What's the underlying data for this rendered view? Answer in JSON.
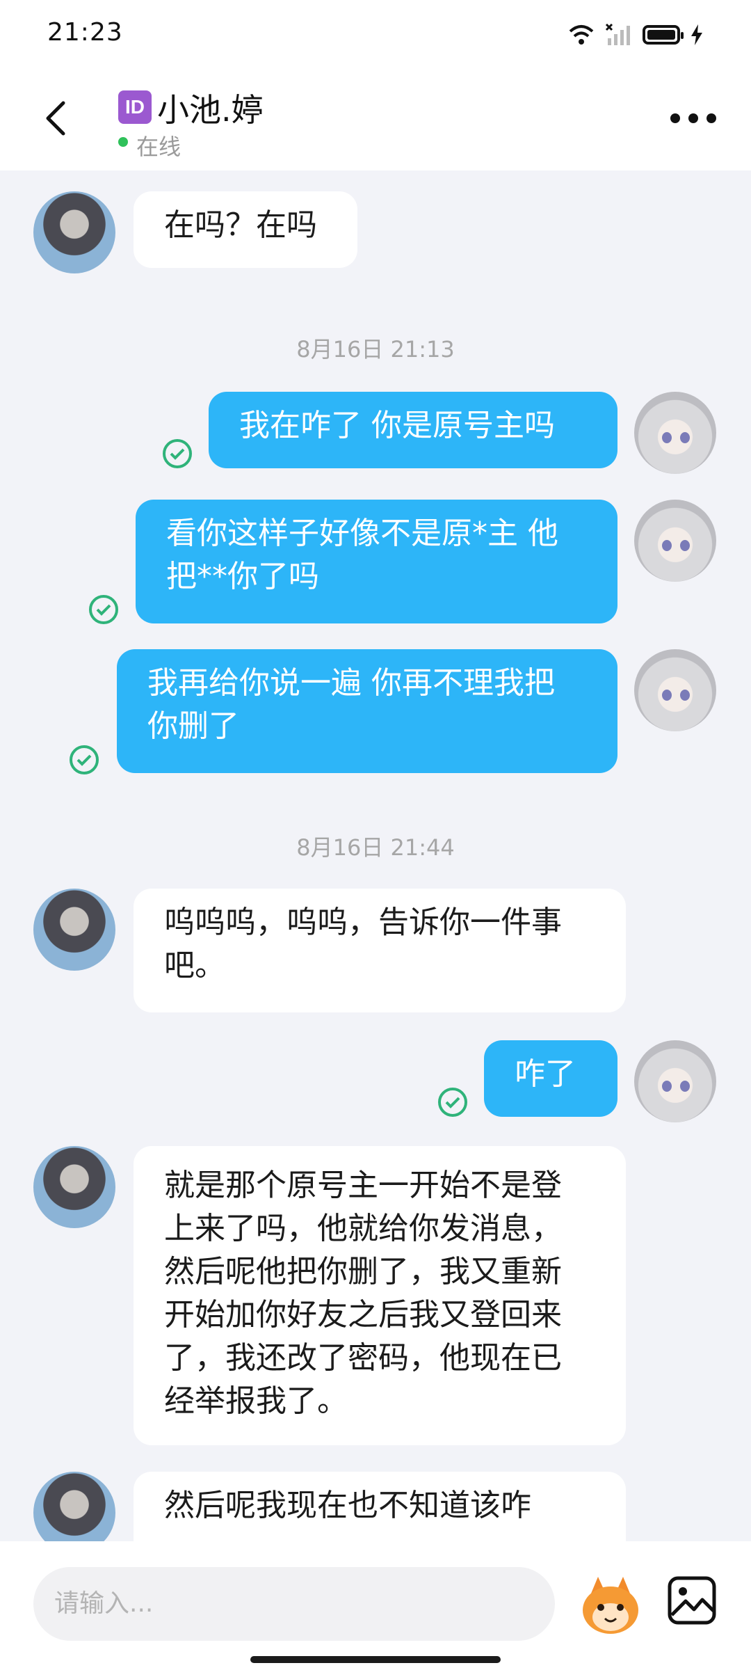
{
  "status_bar": {
    "time": "21:23"
  },
  "header": {
    "badge": "ID",
    "name": "小池.婷",
    "status": "在线"
  },
  "messages": [
    {
      "text": "在吗？在吗"
    },
    {
      "text": "我在咋了 你是原号主吗"
    },
    {
      "line1": "看你这样子好像不是原*主 他",
      "line2": "把**你了吗"
    },
    {
      "line1": "我再给你说一遍 你再不理我把",
      "line2": "你删了"
    },
    {
      "line1": "呜呜呜，呜呜，告诉你一件事",
      "line2": "吧。"
    },
    {
      "text": "咋了"
    },
    {
      "lines": [
        "就是那个原号主一开始不是登",
        "上来了吗，他就给你发消息，",
        "然后呢他把你删了，我又重新",
        "开始加你好友之后我又登回来",
        "了，我还改了密码，他现在已",
        "经举报我了。"
      ]
    },
    {
      "text": "然后呢我现在也不知道该咋"
    }
  ],
  "timestamps": [
    "8月16日 21:13",
    "8月16日 21:44"
  ],
  "input": {
    "placeholder": "请输入..."
  },
  "colors": {
    "outgoing": "#2db5f8",
    "incoming": "#ffffff",
    "online": "#2fc15a",
    "read_check": "#2fb37a"
  },
  "icons": [
    "back-arrow-icon",
    "more-dots-icon",
    "read-check-icon",
    "mascot-sticker-icon",
    "image-icon",
    "wifi-icon",
    "signal-icon",
    "battery-icon",
    "charging-icon"
  ]
}
